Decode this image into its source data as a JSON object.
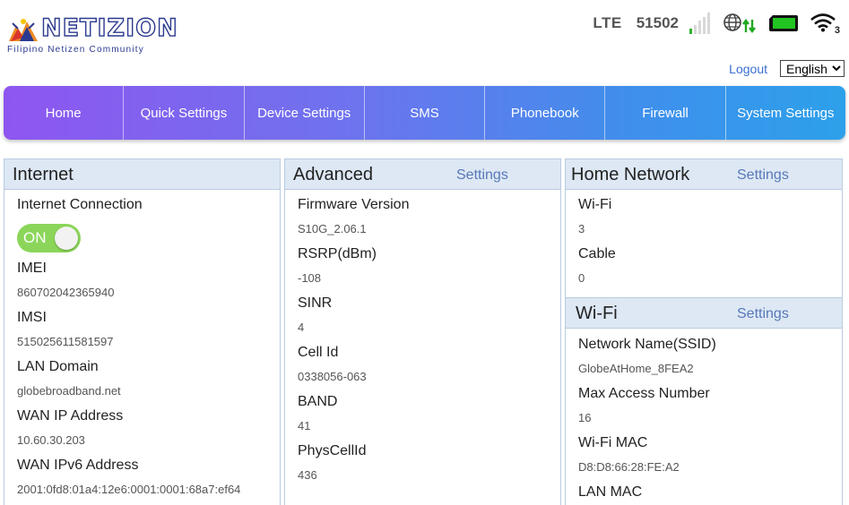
{
  "brand": {
    "name": "NETIZION",
    "tagline": "Filipino Netizen Community"
  },
  "status": {
    "network_type": "LTE",
    "operator_code": "51502",
    "signal_bars_on": 1,
    "signal_bars_total": 5,
    "wifi_clients": "3",
    "colors": {
      "signal_on": "#2fb22f",
      "sim": "#22c422",
      "arrows": "#22a822"
    }
  },
  "top": {
    "logout": "Logout",
    "language": "English",
    "language_options": [
      "English"
    ]
  },
  "nav": [
    {
      "label": "Home"
    },
    {
      "label": "Quick Settings"
    },
    {
      "label": "Device Settings"
    },
    {
      "label": "SMS"
    },
    {
      "label": "Phonebook"
    },
    {
      "label": "Firewall"
    },
    {
      "label": "System Settings"
    }
  ],
  "internet": {
    "title": "Internet",
    "connection_label": "Internet Connection",
    "toggle_state": "ON",
    "toggle_color": "#8bd65a",
    "fields": [
      {
        "label": "IMEI",
        "value": "860702042365940"
      },
      {
        "label": "IMSI",
        "value": "515025611581597"
      },
      {
        "label": "LAN Domain",
        "value": "globebroadband.net"
      },
      {
        "label": "WAN IP Address",
        "value": "10.60.30.203"
      },
      {
        "label": "WAN IPv6 Address",
        "value": "2001:0fd8:01a4:12e6:0001:0001:68a7:ef64"
      }
    ]
  },
  "advanced": {
    "title": "Advanced",
    "settings_link": "Settings",
    "fields": [
      {
        "label": "Firmware Version",
        "value": "S10G_2.06.1"
      },
      {
        "label": "RSRP(dBm)",
        "value": "-108"
      },
      {
        "label": "SINR",
        "value": "4"
      },
      {
        "label": "Cell Id",
        "value": "0338056-063"
      },
      {
        "label": "BAND",
        "value": "41"
      },
      {
        "label": "PhysCellId",
        "value": "436"
      }
    ]
  },
  "home_network": {
    "title": "Home Network",
    "settings_link": "Settings",
    "fields": [
      {
        "label": "Wi-Fi",
        "value": "3"
      },
      {
        "label": "Cable",
        "value": "0"
      }
    ]
  },
  "wifi": {
    "title": "Wi-Fi",
    "settings_link": "Settings",
    "fields": [
      {
        "label": "Network Name(SSID)",
        "value": "GlobeAtHome_8FEA2"
      },
      {
        "label": "Max Access Number",
        "value": "16"
      },
      {
        "label": "Wi-Fi MAC",
        "value": "D8:D8:66:28:FE:A2"
      },
      {
        "label": "LAN MAC",
        "value": ""
      }
    ]
  }
}
